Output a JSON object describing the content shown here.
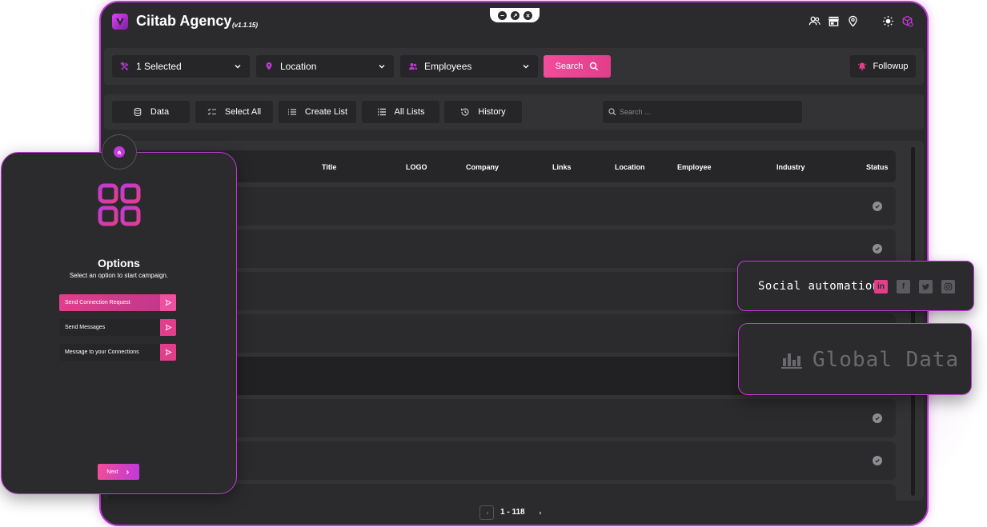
{
  "app": {
    "title": "Ciitab Agency",
    "version": "(v1.1.15)"
  },
  "filters": {
    "selected_label": "1 Selected",
    "location_label": "Location",
    "employees_label": "Employees",
    "search_label": "Search",
    "followup_label": "Followup"
  },
  "actions": {
    "data": "Data",
    "select_all": "Select All",
    "create_list": "Create List",
    "all_lists": "All Lists",
    "history": "History",
    "search_placeholder": "Search ..."
  },
  "table": {
    "columns": [
      "Title",
      "LOGO",
      "Company",
      "Links",
      "Location",
      "Employee",
      "Industry",
      "Status"
    ]
  },
  "pagination": {
    "range": "1 - 118"
  },
  "options_panel": {
    "title": "Options",
    "subtitle": "Select an option to start campaign.",
    "options": [
      "Send Connection Request",
      "Send Messages",
      "Message to your Connections"
    ],
    "next_label": "Next"
  },
  "social": {
    "label": "Social automation",
    "networks": [
      "in",
      "f"
    ]
  },
  "global_data": {
    "label": "Global Data"
  },
  "colors": {
    "accent": "#c13ad8",
    "pink": "#e23e8c",
    "bg": "#2b2b2d"
  }
}
